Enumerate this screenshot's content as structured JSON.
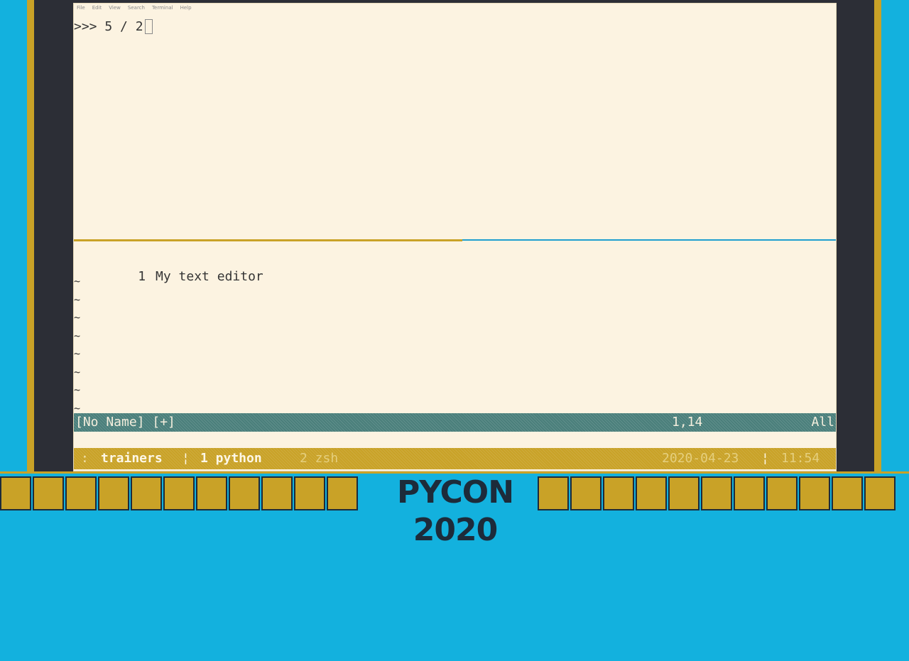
{
  "menubar": [
    "File",
    "Edit",
    "View",
    "Search",
    "Terminal",
    "Help"
  ],
  "python_pane": {
    "prompt": ">>> 5 / 2"
  },
  "vim": {
    "lines": [
      {
        "number": "1",
        "text": "My text editor"
      }
    ],
    "tilde": "~",
    "status_file": "[No Name] [+]",
    "status_position": "1,14",
    "status_scroll": "All"
  },
  "tmux": {
    "colon": ":",
    "session": "trainers",
    "separator": "¦",
    "window_active": "1 python",
    "window_inactive": "2 zsh",
    "date": "2020-04-23",
    "time": "11:54"
  },
  "banner": {
    "title": "PYCON 2020"
  },
  "colors": {
    "background_blue": "#13b1de",
    "gold": "#c9a227",
    "terminal_bg": "#fcf3e1",
    "statusline": "#4a7f7b"
  }
}
